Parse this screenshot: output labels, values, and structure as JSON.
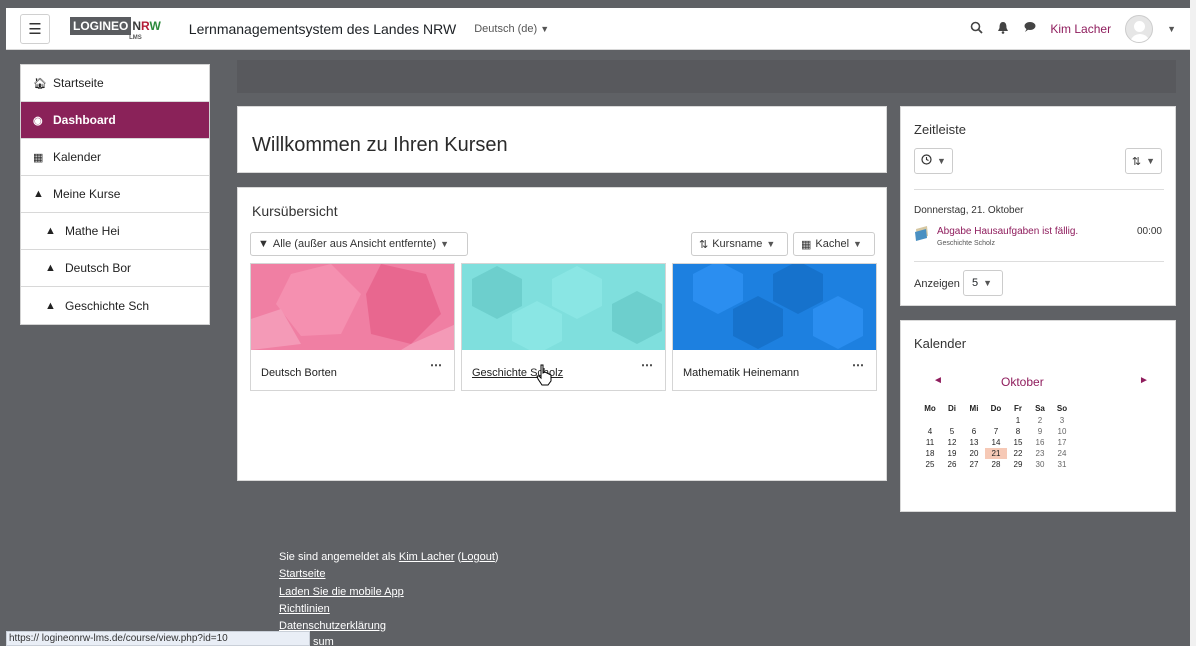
{
  "header": {
    "logo_left": "LOGINEO",
    "logo_n": "N",
    "logo_r": "R",
    "logo_w": "W",
    "logo_sub": "LMS",
    "site_title": "Lernmanagementsystem des Landes NRW",
    "language": "Deutsch (de)",
    "user_name": "Kim Lacher"
  },
  "sidebar": {
    "items": [
      {
        "label": "Startseite",
        "icon": "home-icon"
      },
      {
        "label": "Dashboard",
        "icon": "dashboard-icon"
      },
      {
        "label": "Kalender",
        "icon": "calendar-icon"
      },
      {
        "label": "Meine Kurse",
        "icon": "graduation-cap-icon"
      },
      {
        "label": "Mathe Hei",
        "icon": "graduation-cap-icon"
      },
      {
        "label": "Deutsch Bor",
        "icon": "graduation-cap-icon"
      },
      {
        "label": "Geschichte Sch",
        "icon": "graduation-cap-icon"
      }
    ]
  },
  "main": {
    "welcome_title": "Willkommen zu Ihren Kursen",
    "overview_title": "Kursübersicht",
    "filter_label": "Alle (außer aus Ansicht entfernte)",
    "sort_label": "Kursname",
    "view_label": "Kachel",
    "courses": [
      {
        "name": "Deutsch Borten",
        "color": "#f07fa3"
      },
      {
        "name": "Geschichte Scholz",
        "color": "#7fdfdd"
      },
      {
        "name": "Mathematik Heinemann",
        "color": "#1d80e0"
      }
    ]
  },
  "timeline": {
    "title": "Zeitleiste",
    "date": "Donnerstag, 21. Oktober",
    "event_title": "Abgabe Hausaufgaben ist fällig.",
    "event_course": "Geschichte Scholz",
    "event_time": "00:00",
    "show_label": "Anzeigen",
    "show_value": "5"
  },
  "calendar": {
    "title": "Kalender",
    "month": "Oktober",
    "weekdays": [
      "Mo",
      "Di",
      "Mi",
      "Do",
      "Fr",
      "Sa",
      "So"
    ],
    "weeks": [
      [
        "",
        "",
        "",
        "",
        "1",
        "2",
        "3"
      ],
      [
        "4",
        "5",
        "6",
        "7",
        "8",
        "9",
        "10"
      ],
      [
        "11",
        "12",
        "13",
        "14",
        "15",
        "16",
        "17"
      ],
      [
        "18",
        "19",
        "20",
        "21",
        "22",
        "23",
        "24"
      ],
      [
        "25",
        "26",
        "27",
        "28",
        "29",
        "30",
        "31"
      ]
    ],
    "today": "21"
  },
  "footer": {
    "logged_in_text": "Sie sind angemeldet als",
    "user_link": "Kim Lacher",
    "logout": "Logout",
    "links": [
      "Startseite",
      "Laden Sie die mobile App",
      "Richtlinien",
      "Datenschutzerklärung"
    ],
    "partial_text": "sum"
  },
  "status_url": "https://          logineonrw-lms.de/course/view.php?id=10",
  "colors": {
    "accent": "#8a2259",
    "header_bar": "#58595d"
  }
}
